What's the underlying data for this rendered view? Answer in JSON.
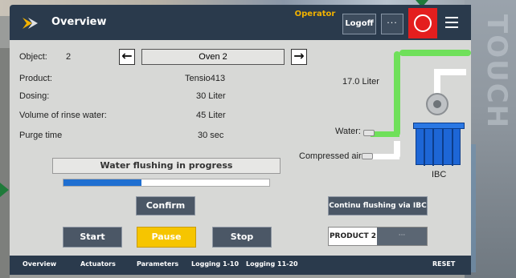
{
  "header": {
    "title": "Overview",
    "role": "Operator",
    "logoff_label": "Logoff",
    "more_label": "···"
  },
  "object": {
    "label": "Object:",
    "number": "2",
    "name": "Oven 2"
  },
  "fields": [
    {
      "label": "Product:",
      "value": "Tensio413"
    },
    {
      "label": "Dosing:",
      "value": "30 Liter"
    },
    {
      "label": "Volume of rinse water:",
      "value": "45 Liter"
    },
    {
      "label": "Purge time",
      "value": "30 sec"
    }
  ],
  "process": {
    "level_value": "17.0 Liter",
    "water_label": "Water:",
    "air_label": "Compressed air:",
    "ibc_label": "IBC"
  },
  "status": {
    "message": "Water flushing in progress",
    "progress": 0.38
  },
  "buttons": {
    "confirm": "Confirm",
    "start": "Start",
    "pause": "Pause",
    "stop": "Stop",
    "continue_ibc": "Continu flushing via IBC"
  },
  "product_toggle": {
    "on_label": "PRODUCT 2",
    "off_label": "···"
  },
  "footer": {
    "tabs": [
      "Overview",
      "Actuators",
      "Parameters",
      "Logging 1-10",
      "Logging 11-20"
    ],
    "reset": "RESET"
  },
  "background": {
    "side_text": "TOUCH"
  },
  "colors": {
    "header": "#2a3a4c",
    "stop_red": "#e41e1e",
    "pause_yellow": "#f6c500",
    "progress_blue": "#1f6fd1",
    "water_pipe_green": "#6fe05a",
    "ibc_blue": "#1d66d6",
    "role_orange": "#f2b200"
  }
}
